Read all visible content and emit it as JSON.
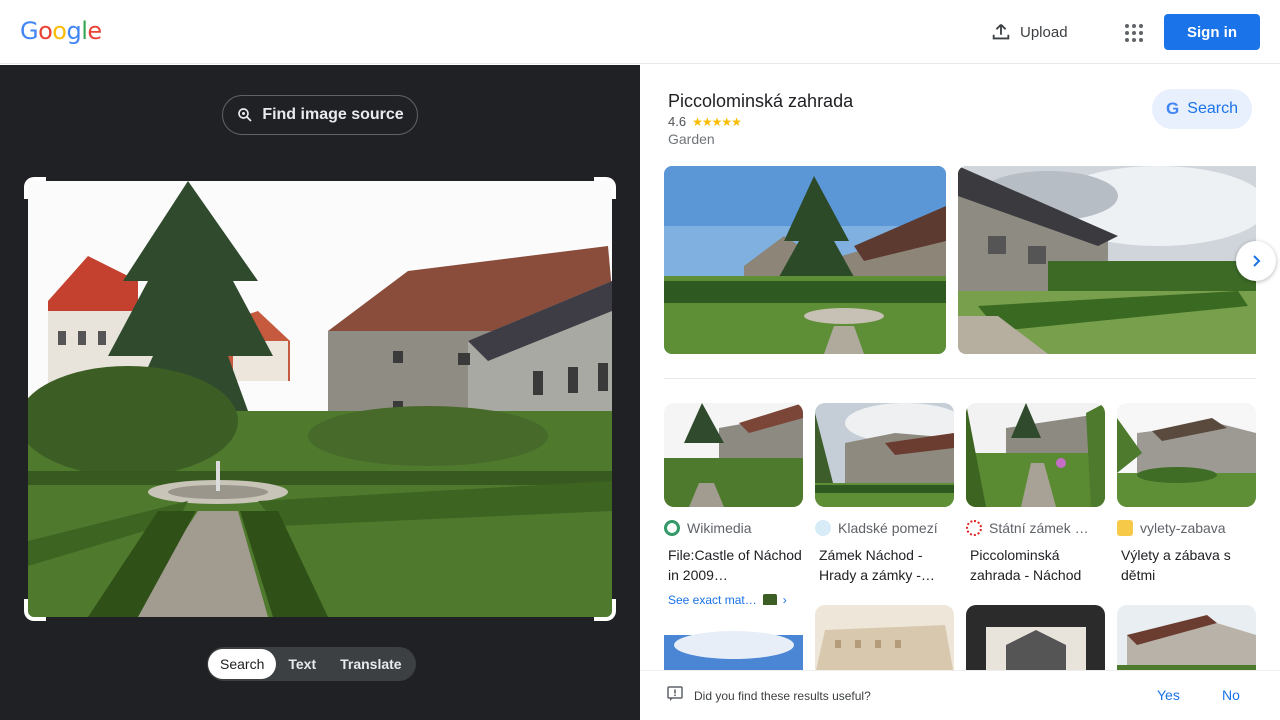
{
  "header": {
    "logo_letters": [
      "G",
      "o",
      "o",
      "g",
      "l",
      "e"
    ],
    "logo_colors": [
      "#4285F4",
      "#EA4335",
      "#FBBC05",
      "#4285F4",
      "#34A853",
      "#EA4335"
    ],
    "upload_label": "Upload",
    "signin_label": "Sign in"
  },
  "lens": {
    "find_source_label": "Find image source",
    "modes": [
      "Search",
      "Text",
      "Translate"
    ],
    "active_mode": "Search"
  },
  "knowledge_panel": {
    "title": "Piccolominská zahrada",
    "rating": "4.6",
    "stars": "★★★★★",
    "type": "Garden",
    "search_label": "Search"
  },
  "results": [
    {
      "source": "Wikimedia",
      "title": "File:Castle of Náchod in 2009…",
      "exact_link": "See exact mat…"
    },
    {
      "source": "Kladské pomezí",
      "title": "Zámek Náchod - Hrady a zámky -…"
    },
    {
      "source": "Státní zámek …",
      "title": "Piccolominská zahrada - Náchod"
    },
    {
      "source": "vylety-zabava",
      "title": "Výlety a zábava s dětmi"
    }
  ],
  "feedback": {
    "question": "Did you find these results useful?",
    "yes": "Yes",
    "no": "No"
  },
  "colors": {
    "accent": "#1a73e8",
    "dark_panel": "#202124"
  }
}
